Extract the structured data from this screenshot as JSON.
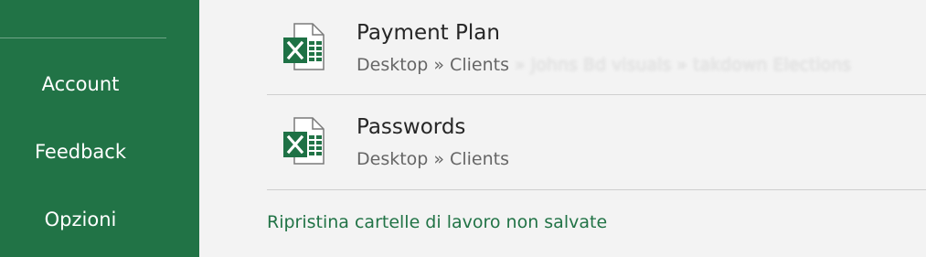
{
  "sidebar": {
    "items": [
      {
        "label": "Account"
      },
      {
        "label": "Feedback"
      },
      {
        "label": "Opzioni"
      }
    ]
  },
  "recent_files": [
    {
      "name": "Payment Plan",
      "path": "Desktop » Clients",
      "path_redacted": "» Johns Bd visuals » takdown Elections",
      "icon": "excel-file-icon"
    },
    {
      "name": "Passwords",
      "path": "Desktop » Clients",
      "icon": "excel-file-icon"
    }
  ],
  "recover_link": "Ripristina cartelle di lavoro non salvate",
  "colors": {
    "excel_green": "#217346",
    "text_primary": "#262626",
    "text_secondary": "#666666"
  }
}
